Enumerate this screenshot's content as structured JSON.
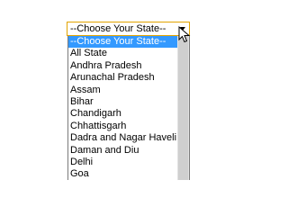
{
  "select": {
    "value": "--Choose Your State--",
    "arrow_icon": "chevron-down-icon"
  },
  "dropdown": {
    "selected_index": 0,
    "options": [
      "--Choose Your State--",
      "All State",
      "Andhra Pradesh",
      "Arunachal Pradesh",
      "Assam",
      "Bihar",
      "Chandigarh",
      "Chhattisgarh",
      "Dadra and Nagar Haveli",
      "Daman and Diu",
      "Delhi",
      "Goa"
    ]
  },
  "colors": {
    "select_border": "#e2a400",
    "selected_option_bg": "#3399ff",
    "scrollbar_track": "#e3e3e3"
  },
  "cursor_icon": "mouse-pointer-icon"
}
